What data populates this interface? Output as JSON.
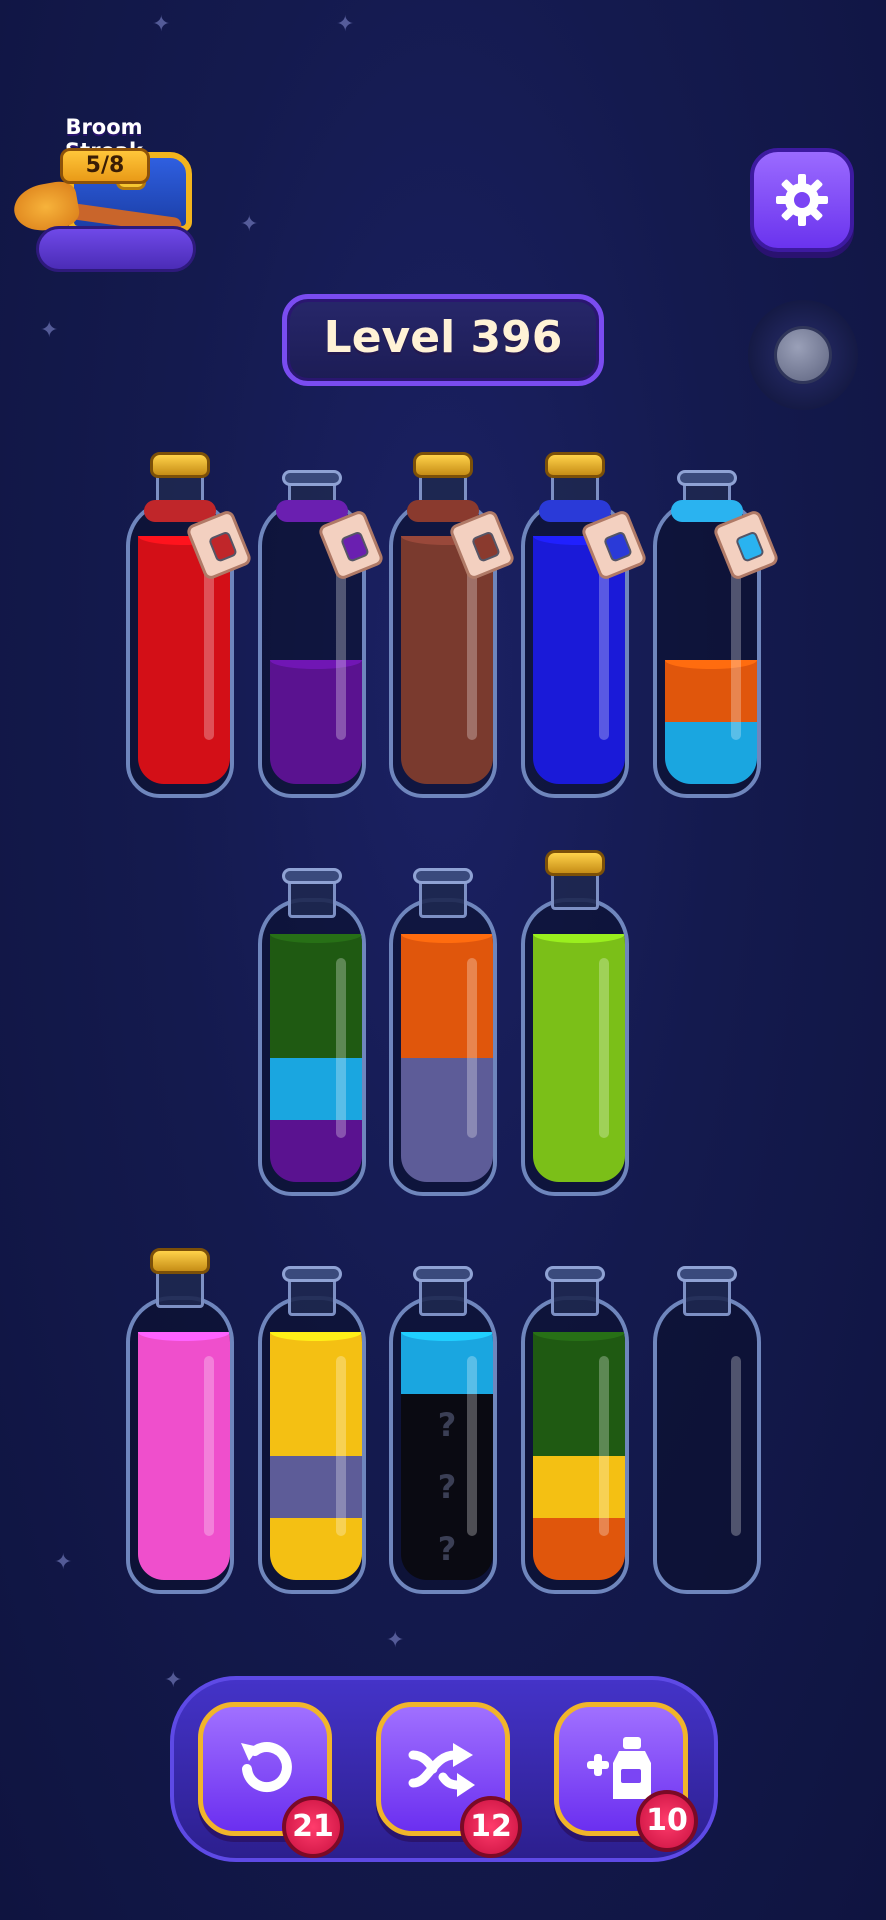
{
  "streak": {
    "title": "Broom Streak",
    "progress": "5/8"
  },
  "level": {
    "label": "Level 396"
  },
  "colors": {
    "red": "#d30f17",
    "purple": "#5a1290",
    "brown": "#7a3a2e",
    "blue": "#1a1ad8",
    "orange": "#e0560c",
    "cyan": "#1aa6e0",
    "darkgreen": "#1f5a12",
    "slate": "#5d5c98",
    "lime": "#7bbf18",
    "pink": "#ef4fcc",
    "yellow": "#f4c013",
    "black": "#0a0a12"
  },
  "bottles": {
    "b1": {
      "corked": true,
      "layers": [
        "red",
        "red",
        "red",
        "red"
      ]
    },
    "b2": {
      "corked": false,
      "layers": [
        "purple",
        "purple"
      ]
    },
    "b3": {
      "corked": true,
      "layers": [
        "brown",
        "brown",
        "brown",
        "brown"
      ]
    },
    "b4": {
      "corked": true,
      "layers": [
        "blue",
        "blue",
        "blue",
        "blue"
      ]
    },
    "b5": {
      "corked": false,
      "layers": [
        "cyan",
        "orange"
      ]
    },
    "b6": {
      "corked": false,
      "layers": [
        "purple",
        "cyan",
        "darkgreen",
        "darkgreen"
      ]
    },
    "b7": {
      "corked": false,
      "layers": [
        "slate",
        "slate",
        "orange",
        "orange"
      ]
    },
    "b8": {
      "corked": true,
      "layers": [
        "lime",
        "lime",
        "lime",
        "lime"
      ]
    },
    "b9": {
      "corked": true,
      "layers": [
        "pink",
        "pink",
        "pink",
        "pink"
      ]
    },
    "b10": {
      "corked": false,
      "layers": [
        "yellow",
        "slate",
        "yellow",
        "yellow"
      ]
    },
    "b11": {
      "corked": false,
      "layers": [
        "hidden",
        "hidden",
        "hidden",
        "cyan"
      ],
      "hidden_mark": "?"
    },
    "b12": {
      "corked": false,
      "layers": [
        "orange",
        "yellow",
        "darkgreen",
        "darkgreen"
      ]
    },
    "b13": {
      "corked": false,
      "layers": []
    }
  },
  "powerups": {
    "undo": {
      "icon": "undo-icon",
      "count": "21"
    },
    "shuffle": {
      "icon": "shuffle-icon",
      "count": "12"
    },
    "add_bottle": {
      "icon": "add-bottle-icon",
      "count": "10"
    }
  }
}
